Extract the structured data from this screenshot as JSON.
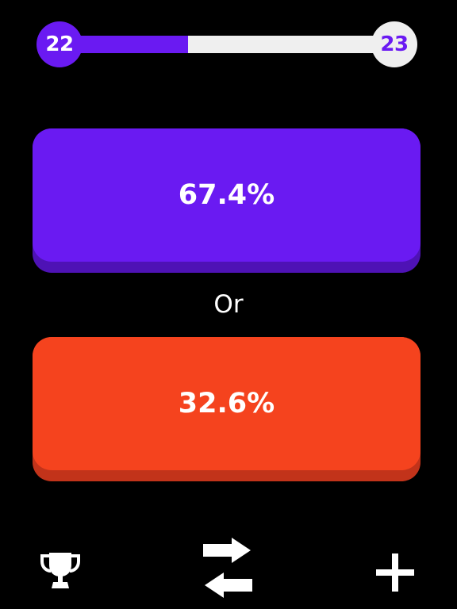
{
  "progress": {
    "current_level": "22",
    "next_level": "23",
    "fraction": 0.37
  },
  "choices": [
    {
      "label": "67.4%",
      "color": "#6a1af2",
      "shadow": "#4e12b5"
    },
    {
      "label": "32.6%",
      "color": "#f5431e",
      "shadow": "#c2331a"
    }
  ],
  "separator": "Or",
  "toolbar": {
    "left_icon": "trophy-icon",
    "center_icon": "swap-arrows-icon",
    "right_icon": "plus-icon"
  },
  "colors": {
    "accent": "#6a1af2",
    "track": "#efefef",
    "background": "#000000"
  }
}
